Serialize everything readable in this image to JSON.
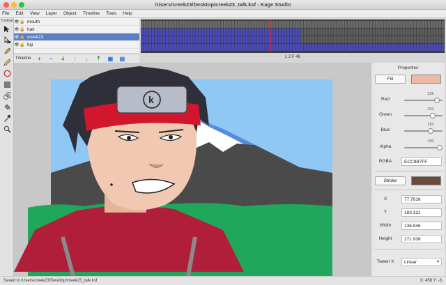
{
  "window": {
    "title": "/Users/creek23/Desktop/creek23_talk.ksf - Kage Studio"
  },
  "menu": [
    "File",
    "Edit",
    "View",
    "Layer",
    "Object",
    "Timeline",
    "Tools",
    "Help"
  ],
  "toolbar": {
    "label": "Toolbar"
  },
  "layers": [
    {
      "name": "mouth",
      "selected": false
    },
    {
      "name": "hair",
      "selected": false
    },
    {
      "name": "creek23",
      "selected": true
    },
    {
      "name": "fuji",
      "selected": false
    }
  ],
  "timeline": {
    "label": "Timeline",
    "frame_info": "L 2 F 46"
  },
  "properties": {
    "title": "Properties",
    "fill_label": "Fill",
    "fill_color": "#ECB9A7",
    "red_label": "Red",
    "red_value": "236",
    "green_label": "Green",
    "green_value": "201",
    "blue_label": "Blue",
    "blue_value": "183",
    "alpha_label": "Alpha",
    "alpha_value": "100",
    "rgba_label": "RGBA",
    "rgba_value": "ECC9B7FF",
    "stroke_label": "Stroke",
    "stroke_color": "#6A4A3A",
    "x_label": "X",
    "x_value": "77.7616",
    "y_label": "Y",
    "y_value": "183.131",
    "width_label": "Width",
    "width_value": "136.946",
    "height_label": "Height",
    "height_value": "271.938",
    "tween_label": "Tween X",
    "tween_value": "Linear"
  },
  "status": {
    "left": "Saved to /Users/creek23/Desktop/creek23_talk.ksf",
    "right": "X: 458 Y: -3"
  },
  "colors": {
    "selection": "#5A7FC4",
    "frame_blue": "#4A4AB8",
    "playhead": "#D32020"
  }
}
